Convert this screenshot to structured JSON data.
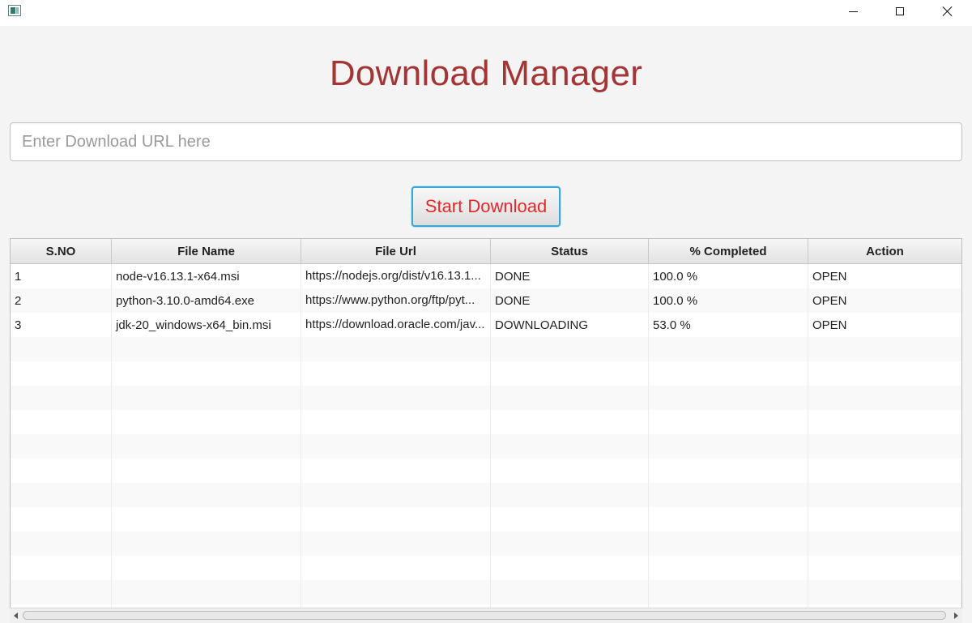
{
  "window": {
    "minimize_icon": "minimize-icon",
    "maximize_icon": "maximize-icon",
    "close_icon": "close-icon"
  },
  "header": {
    "title": "Download Manager"
  },
  "url_input": {
    "placeholder": "Enter Download URL here",
    "value": ""
  },
  "start_button": {
    "label": "Start Download"
  },
  "table": {
    "columns": [
      "S.NO",
      "File Name",
      "File Url",
      "Status",
      "% Completed",
      "Action"
    ],
    "rows": [
      [
        "1",
        "node-v16.13.1-x64.msi",
        "https://nodejs.org/dist/v16.13.1...",
        "DONE",
        "100.0 %",
        "OPEN"
      ],
      [
        "2",
        "python-3.10.0-amd64.exe",
        "https://www.python.org/ftp/pyt...",
        "DONE",
        "100.0 %",
        "OPEN"
      ],
      [
        "3",
        "jdk-20_windows-x64_bin.msi",
        "https://download.oracle.com/jav...",
        "DOWNLOADING",
        "53.0 %",
        "OPEN"
      ]
    ],
    "empty_rows": 12
  },
  "colors": {
    "title": "#a33535",
    "button_text": "#e02a2a",
    "button_focus_border": "#39a6d6"
  }
}
